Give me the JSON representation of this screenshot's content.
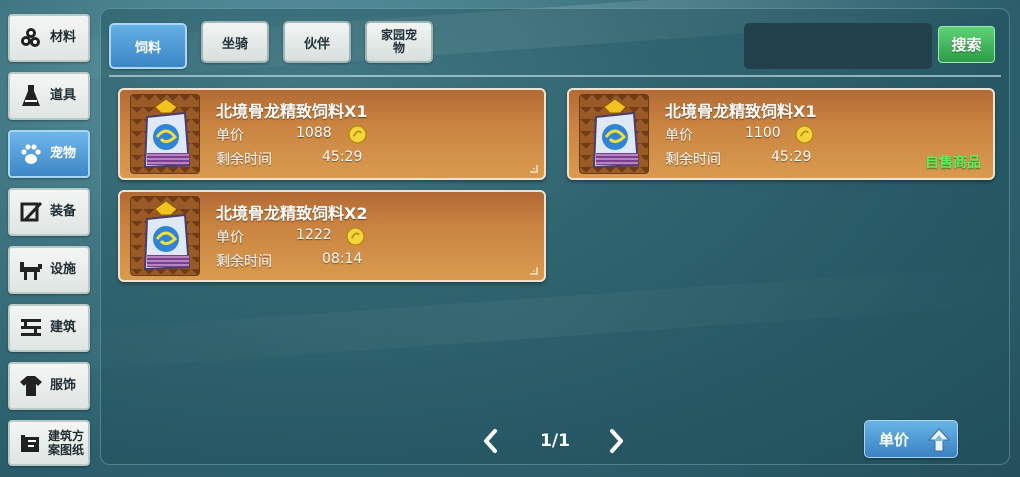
{
  "sidebar": {
    "items": [
      {
        "label": "材料",
        "icon": "materials-icon"
      },
      {
        "label": "道具",
        "icon": "potion-icon"
      },
      {
        "label": "宠物",
        "icon": "paw-icon",
        "active": true
      },
      {
        "label": "装备",
        "icon": "equipment-icon"
      },
      {
        "label": "设施",
        "icon": "facility-icon"
      },
      {
        "label": "建筑",
        "icon": "building-icon"
      },
      {
        "label": "服饰",
        "icon": "clothing-icon"
      },
      {
        "label": "建筑方案图纸",
        "icon": "blueprint-icon"
      }
    ]
  },
  "tabs": [
    {
      "label": "饲料",
      "active": true
    },
    {
      "label": "坐骑"
    },
    {
      "label": "伙伴"
    },
    {
      "label": "家园宠物"
    }
  ],
  "search": {
    "value": "",
    "placeholder": "",
    "button_label": "搜索"
  },
  "listings": [
    {
      "name": "北境骨龙精致饲料X1",
      "price_label": "单价",
      "price": "1088",
      "time_label": "剩余时间",
      "time": "45:29",
      "tag": ""
    },
    {
      "name": "北境骨龙精致饲料X1",
      "price_label": "单价",
      "price": "1100",
      "time_label": "剩余时间",
      "time": "45:29",
      "tag": "自售商品"
    },
    {
      "name": "北境骨龙精致饲料X2",
      "price_label": "单价",
      "price": "1222",
      "time_label": "剩余时间",
      "time": "08:14",
      "tag": ""
    }
  ],
  "pagination": {
    "label": "1/1"
  },
  "sort": {
    "label": "单价",
    "direction": "ascending"
  },
  "colors": {
    "card": "#c98441",
    "active_blue": "#3e87c6",
    "search_green": "#2d9c48",
    "self_tag": "#5cf05a"
  }
}
